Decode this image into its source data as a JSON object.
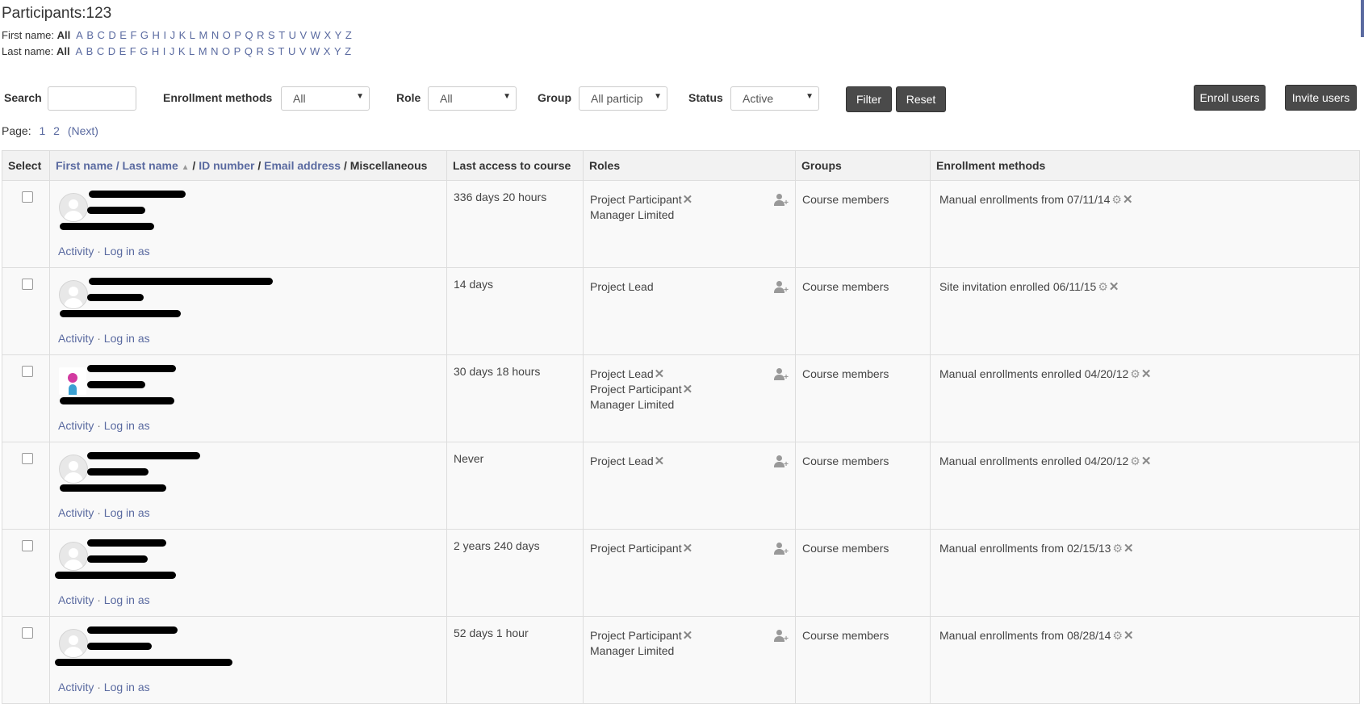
{
  "title": "Participants:123",
  "first_name_label": "First name:",
  "last_name_label": "Last name:",
  "all_label": "All",
  "letters": [
    "A",
    "B",
    "C",
    "D",
    "E",
    "F",
    "G",
    "H",
    "I",
    "J",
    "K",
    "L",
    "M",
    "N",
    "O",
    "P",
    "Q",
    "R",
    "S",
    "T",
    "U",
    "V",
    "W",
    "X",
    "Y",
    "Z"
  ],
  "filters": {
    "search_label": "Search",
    "search_value": "",
    "enrollment_label": "Enrollment methods",
    "enrollment_value": "All",
    "role_label": "Role",
    "role_value": "All",
    "group_label": "Group",
    "group_value": "All particip",
    "status_label": "Status",
    "status_value": "Active",
    "filter_btn": "Filter",
    "reset_btn": "Reset",
    "enroll_btn": "Enroll users",
    "invite_btn": "Invite users"
  },
  "pager": {
    "label": "Page:",
    "p1": "1",
    "p2": "2",
    "next": "(Next)"
  },
  "table": {
    "col_select": "Select",
    "col_first": "First name",
    "col_last": "Last name",
    "col_id": "ID number",
    "col_email": "Email address",
    "col_misc": "Miscellaneous",
    "col_access": "Last access to course",
    "col_roles": "Roles",
    "col_groups": "Groups",
    "col_enroll": "Enrollment methods",
    "slash": "/",
    "activity": "Activity",
    "loginas": "Log in as",
    "rows": [
      {
        "access": "336 days 20 hours",
        "roles": [
          {
            "name": "Project Participant",
            "x": true
          },
          {
            "name": "Manager Limited",
            "x": false
          }
        ],
        "group": "Course members",
        "enroll": "Manual enrollments from 07/11/14"
      },
      {
        "access": "14 days",
        "roles": [
          {
            "name": "Project Lead",
            "x": false
          }
        ],
        "group": "Course members",
        "enroll": "Site invitation enrolled 06/11/15"
      },
      {
        "access": "30 days 18 hours",
        "roles": [
          {
            "name": "Project Lead",
            "x": true
          },
          {
            "name": "Project Participant",
            "x": true
          },
          {
            "name": "Manager Limited",
            "x": false
          }
        ],
        "group": "Course members",
        "enroll": "Manual enrollments enrolled 04/20/12"
      },
      {
        "access": "Never",
        "roles": [
          {
            "name": "Project Lead",
            "x": true
          }
        ],
        "group": "Course members",
        "enroll": "Manual enrollments enrolled 04/20/12"
      },
      {
        "access": "2 years 240 days",
        "roles": [
          {
            "name": "Project Participant",
            "x": true
          }
        ],
        "group": "Course members",
        "enroll": "Manual enrollments from 02/15/13"
      },
      {
        "access": "52 days 1 hour",
        "roles": [
          {
            "name": "Project Participant",
            "x": true
          },
          {
            "name": "Manager Limited",
            "x": false
          }
        ],
        "group": "Course members",
        "enroll": "Manual enrollments from 08/28/14"
      }
    ]
  },
  "colors": {
    "link": "#5a6aa0",
    "button": "#4a4a4a"
  },
  "icons": {
    "remove": "×",
    "gear": "⚙",
    "sort": "▲",
    "dropdown": "▼",
    "assign_role": "user-plus-icon"
  }
}
